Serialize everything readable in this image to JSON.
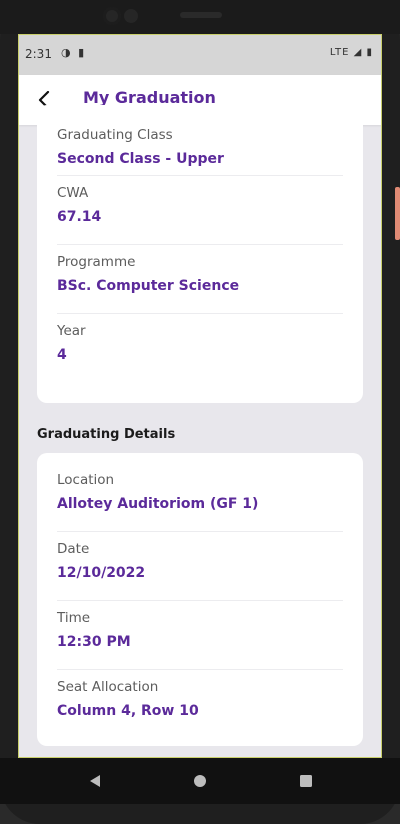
{
  "statusbar": {
    "time": "2:31",
    "left_icons": "◑ ▮",
    "right_icons": "LTE ◢ ▮"
  },
  "appbar": {
    "title": "My Graduation"
  },
  "academic": {
    "items": [
      {
        "label": "Graduating Class",
        "value": "Second Class - Upper"
      },
      {
        "label": "CWA",
        "value": "67.14"
      },
      {
        "label": "Programme",
        "value": "BSc. Computer Science"
      },
      {
        "label": "Year",
        "value": "4"
      }
    ]
  },
  "graduating_details": {
    "title": "Graduating Details",
    "items": [
      {
        "label": "Location",
        "value": "Allotey Auditoriom (GF 1)"
      },
      {
        "label": "Date",
        "value": "12/10/2022"
      },
      {
        "label": "Time",
        "value": "12:30 PM"
      },
      {
        "label": "Seat Allocation",
        "value": "Column 4, Row 10"
      }
    ]
  },
  "colors": {
    "accent": "#5b2a9a",
    "background": "#e8e7ec"
  },
  "icons": {
    "back": "arrow-back-icon",
    "nav_back": "triangle-back-icon",
    "nav_home": "circle-home-icon",
    "nav_recent": "square-recent-icon"
  }
}
